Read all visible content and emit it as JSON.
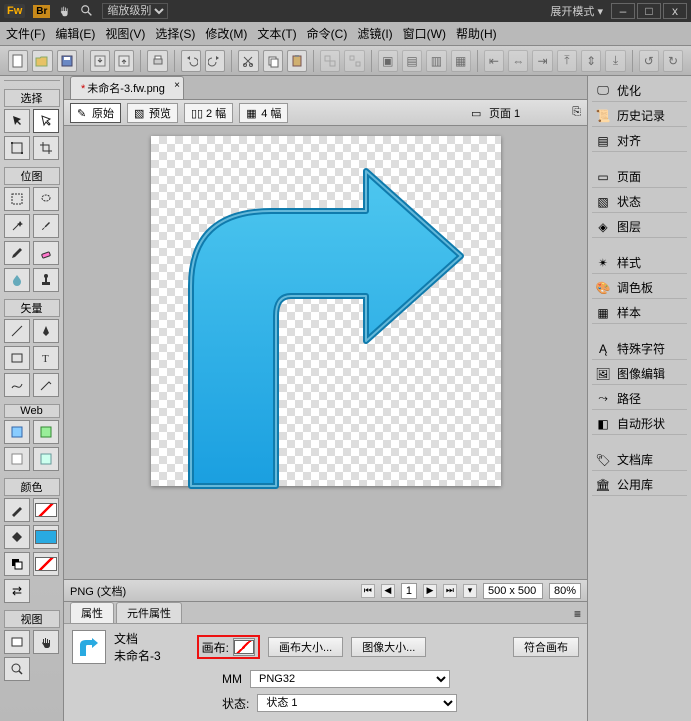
{
  "os_bar": {
    "app": "Fw",
    "bridge": "Br",
    "zoom_label": "缩放级别",
    "mode_label": "展开模式 ▾",
    "win_min": "–",
    "win_max": "□",
    "win_close": "x"
  },
  "menu": {
    "file": "文件(F)",
    "edit": "编辑(E)",
    "view": "视图(V)",
    "select": "选择(S)",
    "modify": "修改(M)",
    "text": "文本(T)",
    "commands": "命令(C)",
    "filters": "滤镜(I)",
    "window": "窗口(W)",
    "help": "帮助(H)"
  },
  "left_tools": {
    "select_label": "选择",
    "bitmap_label": "位图",
    "vector_label": "矢量",
    "web_label": "Web",
    "colors_label": "颜色",
    "view_label": "视图"
  },
  "doc": {
    "tab_name": "未命名-3.fw.png",
    "dirty": "*"
  },
  "view_bar": {
    "original": "原始",
    "preview": "预览",
    "two_up": "2 幅",
    "four_up": "4 幅",
    "page_label": "页面 1"
  },
  "status": {
    "filetype": "PNG (文档)",
    "page": "1",
    "dim": "500 x 500",
    "zoom": "80%"
  },
  "properties": {
    "tab_props": "属性",
    "tab_symbol": "元件属性",
    "doc_label": "文档",
    "doc_name": "未命名-3",
    "canvas_label": "画布:",
    "canvas_size_btn": "画布大小...",
    "image_size_btn": "图像大小...",
    "fit_canvas_btn": "符合画布",
    "format_label": "MM",
    "format_value": "PNG32",
    "state_label": "状态:",
    "state_value": "状态 1"
  },
  "right": {
    "optimize": "优化",
    "history": "历史记录",
    "align": "对齐",
    "pages": "页面",
    "states": "状态",
    "layers": "图层",
    "styles": "样式",
    "swatches": "调色板",
    "palette": "样本",
    "special_chars": "特殊字符",
    "image_editing": "图像编辑",
    "path": "路径",
    "auto_shapes": "自动形状",
    "doc_library": "文档库",
    "common_library": "公用库"
  }
}
